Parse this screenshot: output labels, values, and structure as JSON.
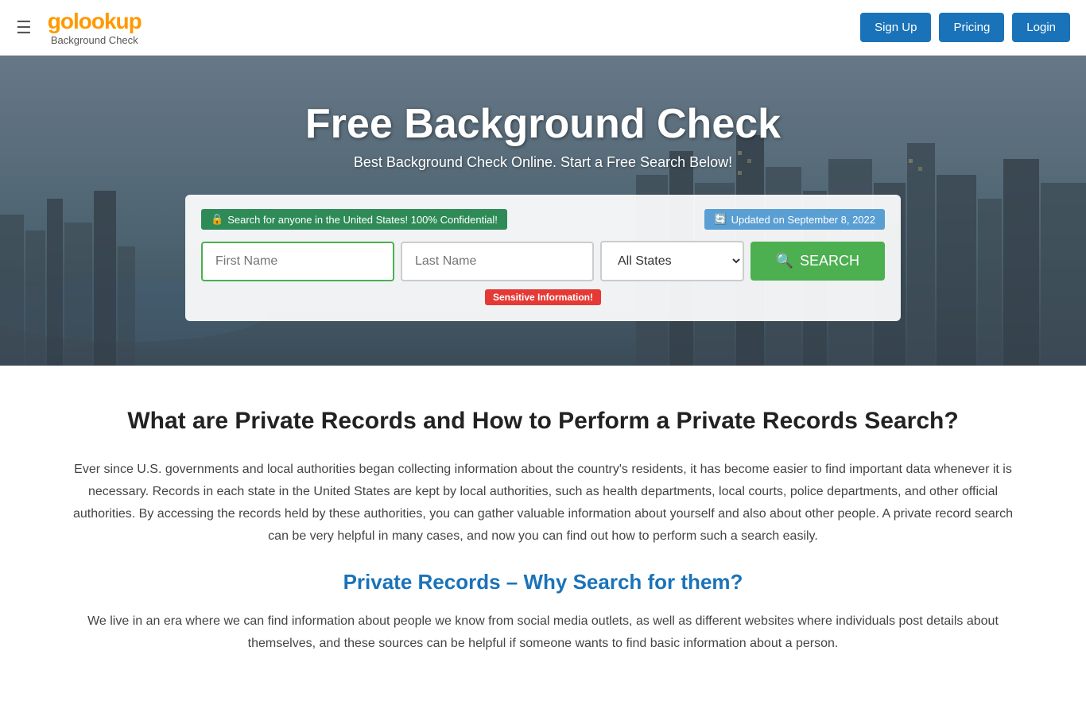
{
  "header": {
    "hamburger_icon": "☰",
    "logo_text_before": "go",
    "logo_highlight": "loo",
    "logo_text_after": "kup",
    "logo_subtitle": "Background Check",
    "signup_label": "Sign Up",
    "pricing_label": "Pricing",
    "login_label": "Login"
  },
  "hero": {
    "title": "Free Background Check",
    "subtitle": "Best Background Check Online. Start a Free Search Below!",
    "search": {
      "notice_green": "🔒 Search for anyone in the United States! 100% Confidential!",
      "notice_blue": "🔄 Updated on September 8, 2022",
      "first_name_placeholder": "First Name",
      "last_name_placeholder": "Last Name",
      "state_default": "All States",
      "search_button": "SEARCH",
      "sensitive_label": "Sensitive Information!"
    }
  },
  "content": {
    "heading": "What are Private Records and How to Perform a Private Records Search?",
    "paragraph1": "Ever since U.S. governments and local authorities began collecting information about the country's residents, it has become easier to find important data whenever it is necessary. Records in each state in the United States are kept by local authorities, such as health departments, local courts, police departments, and other official authorities. By accessing the records held by these authorities, you can gather valuable information about yourself and also about other people. A private record search can be very helpful in many cases, and now you can find out how to perform such a search easily.",
    "subheading_highlight": "Private Records",
    "subheading_rest": " – Why Search for them?",
    "paragraph2": "We live in an era where we can find information about people we know from social media outlets, as well as different websites where individuals post details about themselves, and these sources can be helpful if someone wants to find basic information about a person."
  }
}
